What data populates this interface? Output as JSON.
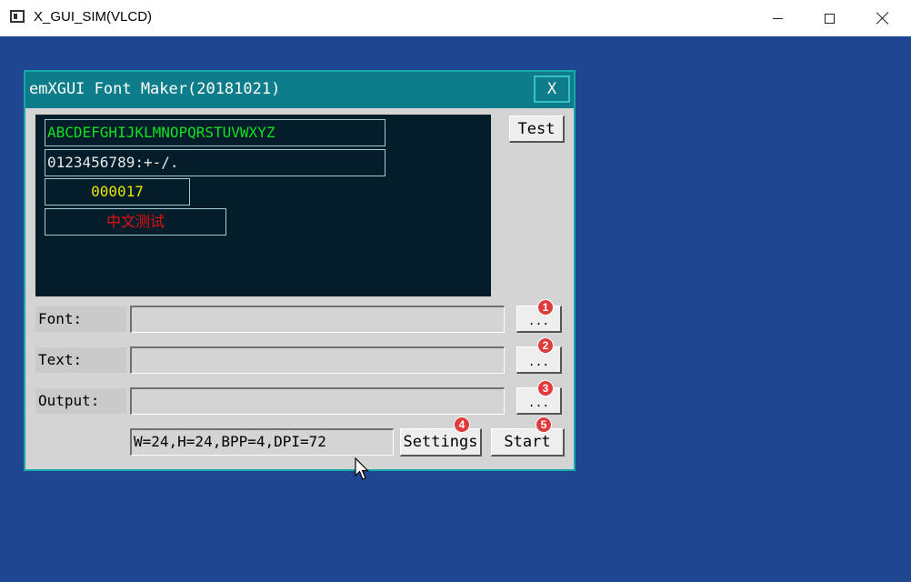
{
  "window": {
    "title": "X_GUI_SIM(VLCD)",
    "background_color": "#1f4690",
    "controls": {
      "minimize": "minimize-icon",
      "maximize": "maximize-icon",
      "close": "close-icon"
    }
  },
  "app": {
    "title": "emXGUI Font Maker(20181021)",
    "close_label": "X",
    "border_color": "#1aa7a7",
    "titlebar_color": "#0d7d8b",
    "preview": {
      "background_color": "#031d2b",
      "lines": [
        {
          "text": "ABCDEFGHIJKLMNOPQRSTUVWXYZ",
          "color": "#10e020"
        },
        {
          "text": "0123456789:+-/.",
          "color": "#e8e8e8"
        },
        {
          "text": "000017",
          "color": "#e6e600"
        },
        {
          "text": "中文测试",
          "color": "#e81010"
        }
      ]
    },
    "test_button": "Test",
    "fields": [
      {
        "label": "Font:",
        "value": "",
        "button": "...",
        "badge": "1"
      },
      {
        "label": "Text:",
        "value": "",
        "button": "...",
        "badge": "2"
      },
      {
        "label": "Output:",
        "value": "",
        "button": "...",
        "badge": "3"
      }
    ],
    "info": "W=24,H=24,BPP=4,DPI=72",
    "settings_button": "Settings",
    "settings_badge": "4",
    "start_button": "Start",
    "start_badge": "5",
    "badge_color": "#e03a3a"
  }
}
